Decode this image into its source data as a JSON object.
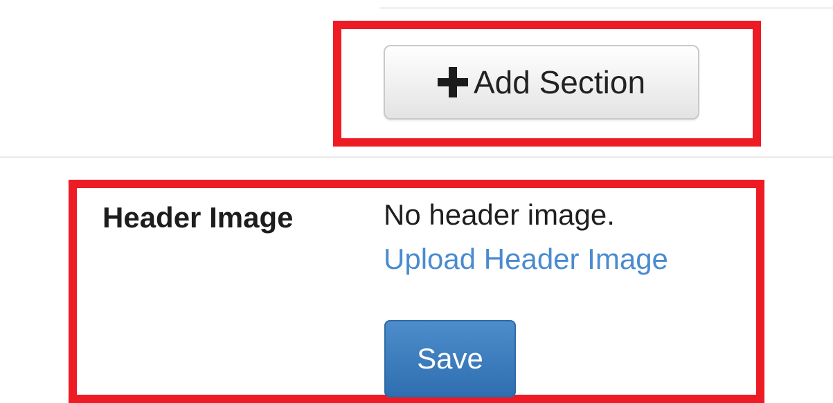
{
  "toolbar": {
    "add_section_label": "Add Section",
    "add_section_icon": "plus-icon"
  },
  "header_image": {
    "label": "Header Image",
    "status_text": "No header image.",
    "upload_link_text": "Upload Header Image",
    "save_label": "Save"
  },
  "colors": {
    "highlight": "#ed1c24",
    "link": "#4a8bd0",
    "primary_button": "#337ab7",
    "default_button": "#f2f2f2"
  }
}
